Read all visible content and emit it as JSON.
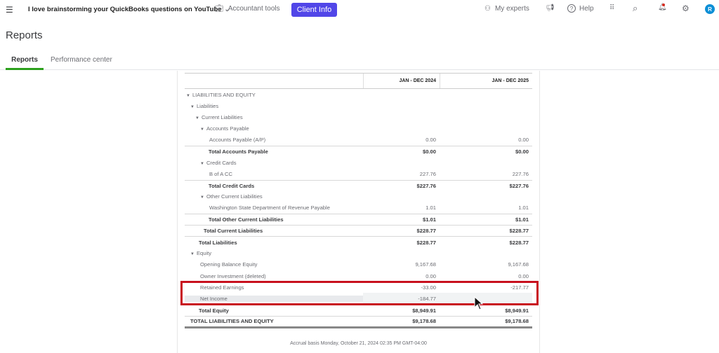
{
  "topbar": {
    "company": "I love brainstorming your QuickBooks questions on YouTube",
    "accountant_tools": "Accountant tools",
    "client_info": "Client Info",
    "my_experts": "My experts",
    "help": "Help",
    "avatar": "R"
  },
  "page_title": "Reports",
  "tabs": [
    "Reports",
    "Performance center"
  ],
  "report": {
    "columns": [
      "JAN - DEC 2024",
      "JAN - DEC 2025"
    ],
    "rows": [
      {
        "label": "LIABILITIES AND EQUITY",
        "level": 0,
        "caret": true,
        "v1": "",
        "v2": ""
      },
      {
        "label": "Liabilities",
        "level": 1,
        "caret": true,
        "v1": "",
        "v2": ""
      },
      {
        "label": "Current Liabilities",
        "level": 2,
        "caret": true,
        "v1": "",
        "v2": ""
      },
      {
        "label": "Accounts Payable",
        "level": 3,
        "caret": true,
        "v1": "",
        "v2": ""
      },
      {
        "label": "Accounts Payable (A/P)",
        "level": 4,
        "v1": "0.00",
        "v2": "0.00"
      },
      {
        "label": "Total Accounts Payable",
        "level": 4,
        "bold": true,
        "v1": "$0.00",
        "v2": "$0.00"
      },
      {
        "label": "Credit Cards",
        "level": 3,
        "caret": true,
        "v1": "",
        "v2": ""
      },
      {
        "label": "B of A CC",
        "level": 4,
        "v1": "227.76",
        "v2": "227.76"
      },
      {
        "label": "Total Credit Cards",
        "level": 4,
        "bold": true,
        "v1": "$227.76",
        "v2": "$227.76"
      },
      {
        "label": "Other Current Liabilities",
        "level": 3,
        "caret": true,
        "v1": "",
        "v2": ""
      },
      {
        "label": "Washington State Department of Revenue Payable",
        "level": 4,
        "v1": "1.01",
        "v2": "1.01"
      },
      {
        "label": "Total Other Current Liabilities",
        "level": 4,
        "bold": true,
        "v1": "$1.01",
        "v2": "$1.01"
      },
      {
        "label": "Total Current Liabilities",
        "level": 3,
        "bold": true,
        "v1": "$228.77",
        "v2": "$228.77"
      },
      {
        "label": "Total Liabilities",
        "level": 2,
        "bold": true,
        "v1": "$228.77",
        "v2": "$228.77"
      },
      {
        "label": "Equity",
        "level": 1,
        "caret": true,
        "v1": "",
        "v2": ""
      },
      {
        "label": "Opening Balance Equity",
        "level": 2,
        "v1": "9,167.68",
        "v2": "9,167.68"
      },
      {
        "label": "Owner Investment (deleted)",
        "level": 2,
        "v1": "0.00",
        "v2": "0.00"
      },
      {
        "label": "Retained Earnings",
        "level": 2,
        "v1": "-33.00",
        "v2": "-217.77"
      },
      {
        "label": "Net Income",
        "level": 2,
        "highlight": true,
        "v1": "-184.77",
        "v2": ""
      },
      {
        "label": "Total Equity",
        "level": 2,
        "bold": true,
        "v1": "$8,949.91",
        "v2": "$8,949.91"
      },
      {
        "label": "TOTAL LIABILITIES AND EQUITY",
        "level": 0,
        "grand": true,
        "v1": "$9,178.68",
        "v2": "$9,178.68"
      }
    ],
    "footer": "Accrual basis  Monday, October 21, 2024  02:35 PM GMT-04:00"
  },
  "colors": {
    "accent": "#5146e8",
    "tab_active": "#2ca01c",
    "highlight_box": "#c8101e"
  }
}
